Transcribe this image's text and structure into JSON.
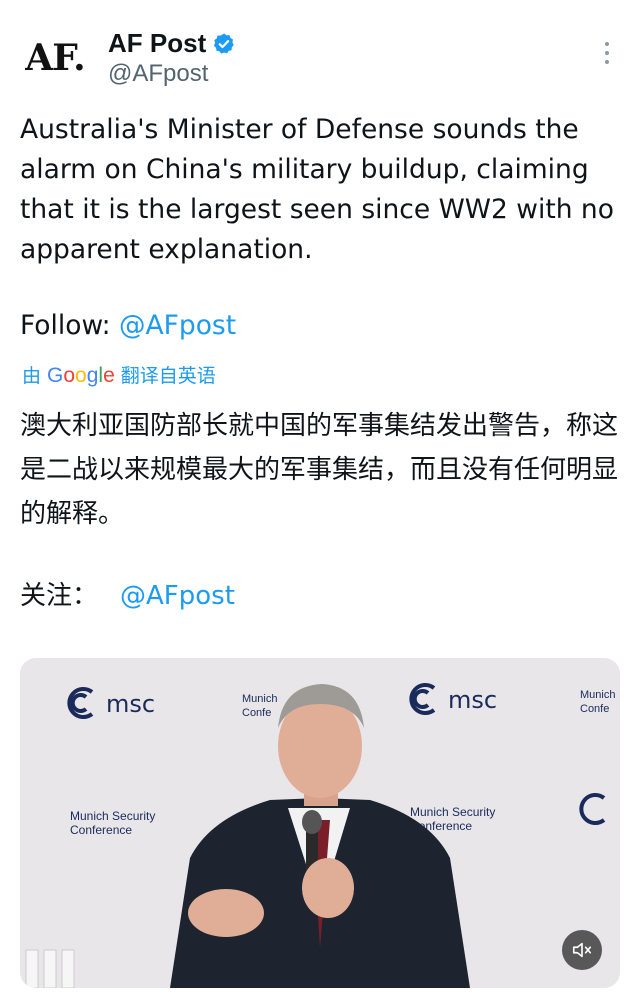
{
  "account": {
    "avatar_text": "AF.",
    "display_name": "AF Post",
    "handle": "@AFpost",
    "verified": true
  },
  "tweet": {
    "text": "Australia's Minister of Defense sounds the alarm on China's military buildup, claiming that it is the largest seen since WW2 with no apparent explanation.",
    "follow_label": "Follow: ",
    "follow_link": "@AFpost"
  },
  "translation": {
    "translated_by_prefix": "由",
    "translated_by_brand": "Google",
    "translated_by_suffix": "翻译自英语",
    "text": "澳大利亚国防部长就中国的军事集结发出警告，称这是二战以来规模最大的军事集结，而且没有任何明显的解释。",
    "follow_label": "关注：",
    "follow_link": "@AFpost"
  },
  "media": {
    "backdrop_logo_text": "msc",
    "backdrop_caption_line1": "Munich Security",
    "backdrop_caption_line2": "Conference",
    "backdrop_partial_line1": "Munich",
    "backdrop_partial_line2": "Confe",
    "mute_icon": "speaker-muted-icon"
  },
  "colors": {
    "link": "#1d9bf0",
    "text": "#0f1419",
    "secondary": "#536471",
    "verified": "#1d9bf0"
  }
}
